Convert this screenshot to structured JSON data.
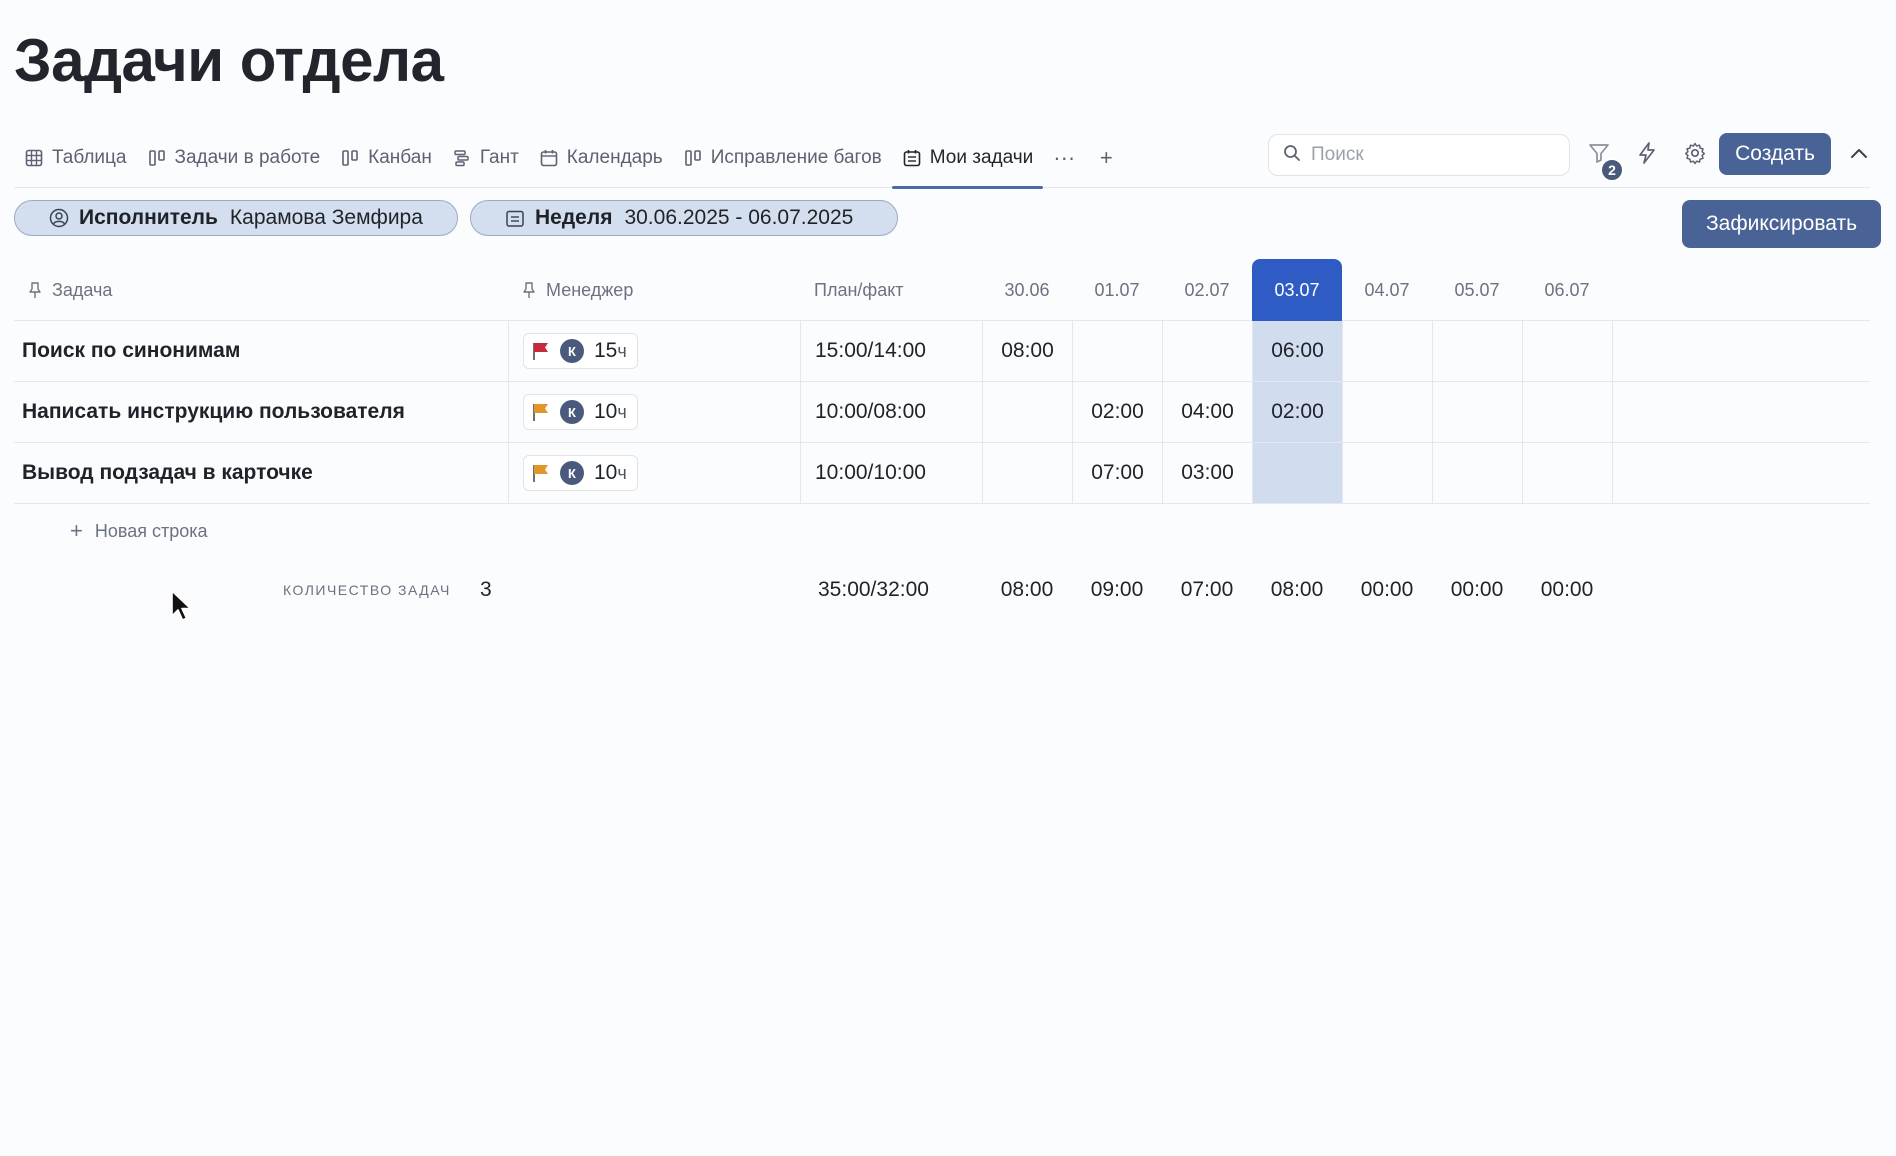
{
  "page": {
    "title": "Задачи отдела"
  },
  "tabs": [
    {
      "label": "Таблица",
      "icon": "table-icon"
    },
    {
      "label": "Задачи в работе",
      "icon": "board-icon"
    },
    {
      "label": "Канбан",
      "icon": "board-icon"
    },
    {
      "label": "Гант",
      "icon": "gantt-icon"
    },
    {
      "label": "Календарь",
      "icon": "calendar-icon"
    },
    {
      "label": "Исправление багов",
      "icon": "board-icon"
    },
    {
      "label": "Мои задачи",
      "icon": "calendar-list-icon",
      "active": true
    }
  ],
  "toolbar": {
    "more_label": "···",
    "add_label": "+",
    "search_placeholder": "Поиск",
    "filter_badge": "2",
    "create_label": "Создать"
  },
  "filters": {
    "assignee_key": "Исполнитель",
    "assignee_value": "Карамова Земфира",
    "week_key": "Неделя",
    "week_value": "30.06.2025 - 06.07.2025"
  },
  "fix_label": "Зафиксировать",
  "table": {
    "headers": {
      "task": "Задача",
      "manager": "Менеджер",
      "plan": "План/факт",
      "days": [
        "30.06",
        "01.07",
        "02.07",
        "03.07",
        "04.07",
        "05.07",
        "06.07"
      ]
    },
    "rows": [
      {
        "task": "Поиск по синонимам",
        "flag_color": "#c8283c",
        "avatar": "К",
        "hours": "15",
        "unit": "ч",
        "plan": "15:00/14:00",
        "days": [
          "08:00",
          "",
          "",
          "06:00",
          "",
          "",
          ""
        ]
      },
      {
        "task": "Написать инструкцию пользователя",
        "flag_color": "#e0962a",
        "avatar": "К",
        "hours": "10",
        "unit": "ч",
        "plan": "10:00/08:00",
        "days": [
          "",
          "02:00",
          "04:00",
          "02:00",
          "",
          "",
          ""
        ]
      },
      {
        "task": "Вывод подзадач в карточке",
        "flag_color": "#e0962a",
        "avatar": "К",
        "hours": "10",
        "unit": "ч",
        "plan": "10:00/10:00",
        "days": [
          "",
          "07:00",
          "03:00",
          "",
          "",
          "",
          ""
        ]
      }
    ],
    "new_row_label": "Новая строка"
  },
  "summary": {
    "label": "КОЛИЧЕСТВО ЗАДАЧ",
    "count": "3",
    "plan": "35:00/32:00",
    "days": [
      "08:00",
      "09:00",
      "07:00",
      "08:00",
      "00:00",
      "00:00",
      "00:00"
    ]
  },
  "colors": {
    "accent": "#4a6396",
    "today": "#2f5cc4",
    "today_fill": "#d1dcef"
  }
}
